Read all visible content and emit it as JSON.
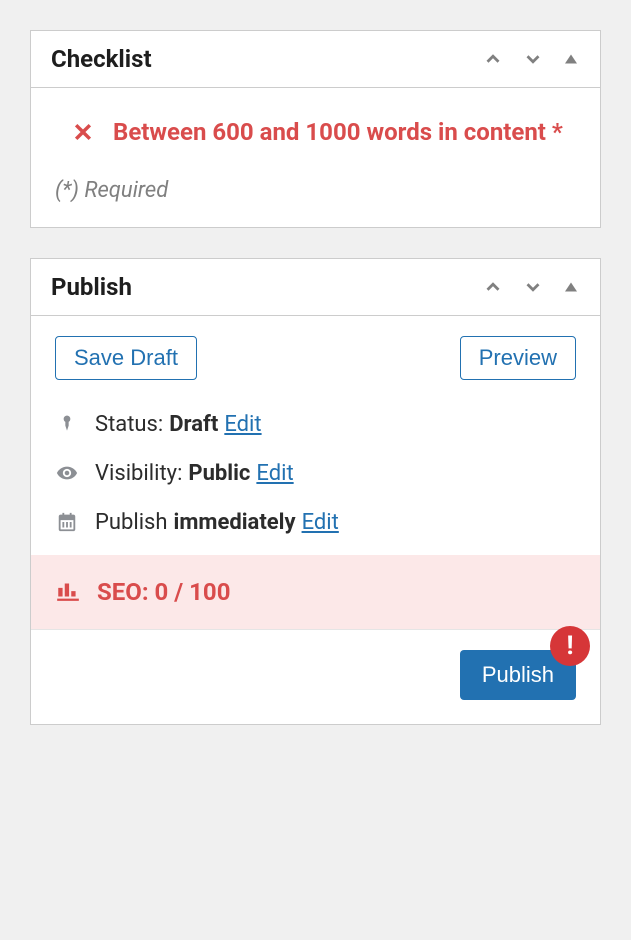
{
  "checklist": {
    "title": "Checklist",
    "item_text": "Between 600 and 1000 words in content *",
    "required_note": "(*) Required"
  },
  "publish": {
    "title": "Publish",
    "save_draft_label": "Save Draft",
    "preview_label": "Preview",
    "status_label": "Status:",
    "status_value": "Draft",
    "status_edit": "Edit",
    "visibility_label": "Visibility:",
    "visibility_value": "Public",
    "visibility_edit": "Edit",
    "schedule_label": "Publish",
    "schedule_value": "immediately",
    "schedule_edit": "Edit",
    "seo_label": "SEO: 0 / 100",
    "publish_button": "Publish",
    "alert_text": "!"
  }
}
